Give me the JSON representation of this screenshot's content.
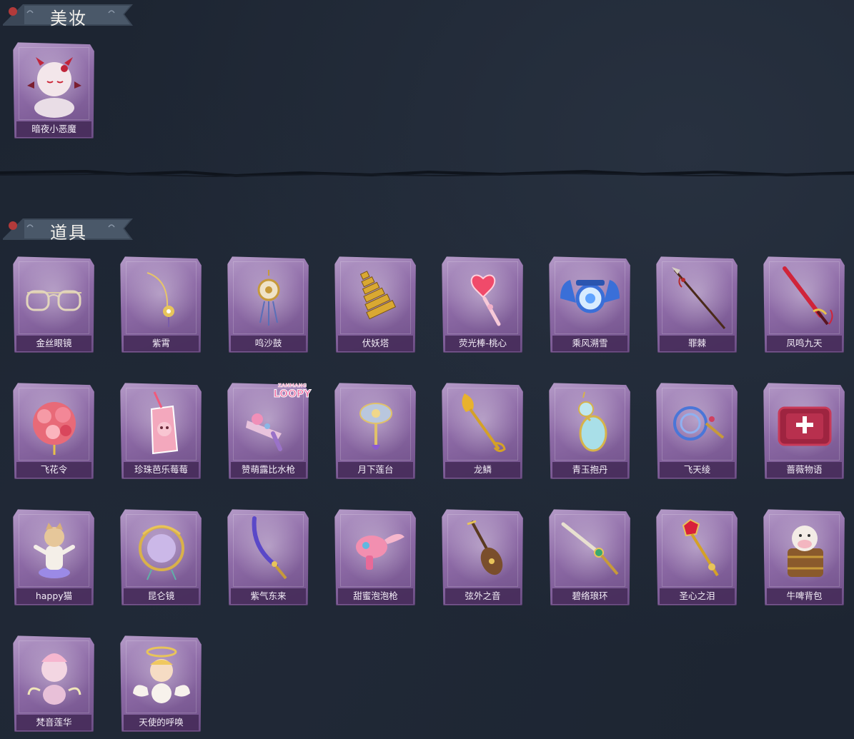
{
  "sections": {
    "makeup": {
      "title": "美妆",
      "items": [
        {
          "name": "暗夜小恶魔",
          "icon": "devil-face-icon"
        }
      ]
    },
    "props": {
      "title": "道具",
      "items": [
        {
          "name": "金丝眼镜",
          "icon": "glasses-icon"
        },
        {
          "name": "紫霄",
          "icon": "pendant-icon"
        },
        {
          "name": "鸣沙鼓",
          "icon": "drum-icon"
        },
        {
          "name": "伏妖塔",
          "icon": "pagoda-icon"
        },
        {
          "name": "荧光棒-桃心",
          "icon": "heart-wand-icon"
        },
        {
          "name": "乘风溯雪",
          "icon": "snow-lantern-icon"
        },
        {
          "name": "罪棘",
          "icon": "spear-icon"
        },
        {
          "name": "凤鸣九天",
          "icon": "red-sword-icon"
        },
        {
          "name": "飞花令",
          "icon": "flower-bouquet-icon"
        },
        {
          "name": "珍珠芭乐莓莓",
          "icon": "drink-cup-icon"
        },
        {
          "name": "赞萌露比水枪",
          "icon": "water-gun-icon",
          "badge": "ZANMANG LOOPY"
        },
        {
          "name": "月下莲台",
          "icon": "lotus-scepter-icon"
        },
        {
          "name": "龙鳞",
          "icon": "golden-shovel-icon"
        },
        {
          "name": "青玉抱丹",
          "icon": "jade-gourd-icon"
        },
        {
          "name": "飞天绫",
          "icon": "ribbon-icon"
        },
        {
          "name": "蔷薇物语",
          "icon": "medkit-icon"
        },
        {
          "name": "happy猫",
          "icon": "cat-figure-icon"
        },
        {
          "name": "昆仑镜",
          "icon": "mirror-icon"
        },
        {
          "name": "紫气东来",
          "icon": "purple-blade-icon"
        },
        {
          "name": "甜蜜泡泡枪",
          "icon": "bubble-gun-icon"
        },
        {
          "name": "弦外之音",
          "icon": "pipa-icon"
        },
        {
          "name": "碧络琅环",
          "icon": "jade-sword-icon"
        },
        {
          "name": "圣心之泪",
          "icon": "gem-scepter-icon"
        },
        {
          "name": "牛啤背包",
          "icon": "cow-backpack-icon"
        },
        {
          "name": "梵音莲华",
          "icon": "angel-doll-icon"
        },
        {
          "name": "天使的呼唤",
          "icon": "angel-halo-icon"
        }
      ]
    }
  }
}
